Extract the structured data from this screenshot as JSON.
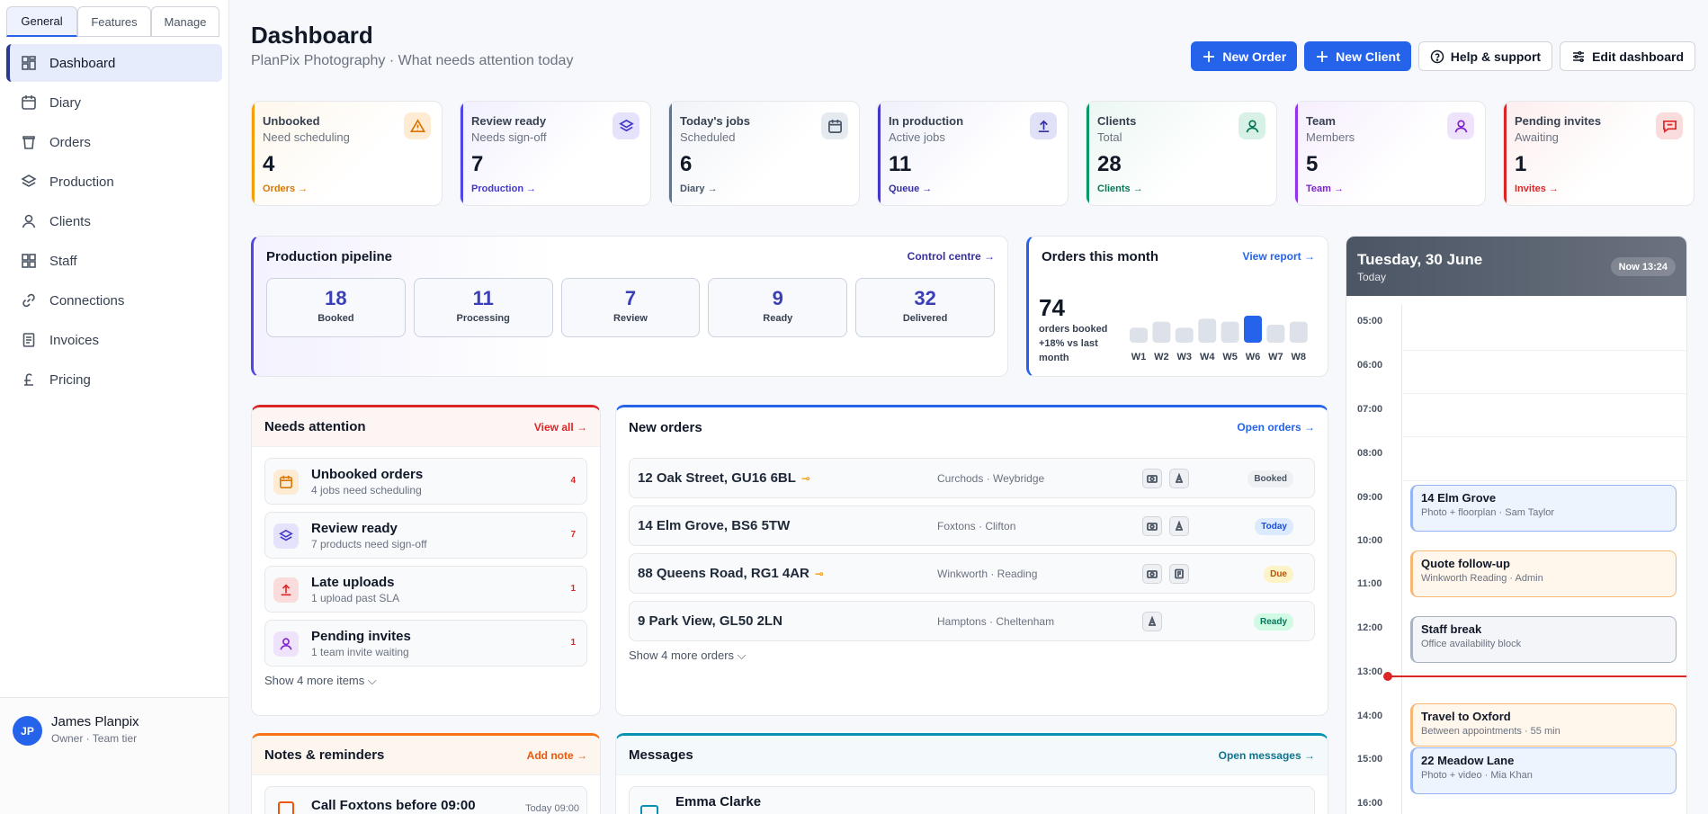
{
  "sidebar": {
    "tabs": [
      "General",
      "Features",
      "Manage"
    ],
    "items": [
      {
        "label": "Dashboard",
        "icon": "dashboard-icon"
      },
      {
        "label": "Diary",
        "icon": "calendar-icon"
      },
      {
        "label": "Orders",
        "icon": "bag-icon"
      },
      {
        "label": "Production",
        "icon": "layers-icon"
      },
      {
        "label": "Clients",
        "icon": "user-icon"
      },
      {
        "label": "Staff",
        "icon": "grid-icon"
      },
      {
        "label": "Connections",
        "icon": "link-icon"
      },
      {
        "label": "Invoices",
        "icon": "receipt-icon"
      },
      {
        "label": "Pricing",
        "icon": "pound-icon"
      }
    ],
    "user": {
      "initials": "JP",
      "name": "James Planpix",
      "role": "Owner · Team tier"
    }
  },
  "header": {
    "title": "Dashboard",
    "subtitle": "PlanPix Photography · What needs attention today",
    "new_order": "New Order",
    "new_client": "New Client",
    "help": "Help & support",
    "edit": "Edit dashboard"
  },
  "stats": [
    {
      "title": "Unbooked",
      "sub": "Need scheduling",
      "value": "4",
      "link": "Orders →",
      "color": "#f59e0b"
    },
    {
      "title": "Review ready",
      "sub": "Needs sign-off",
      "value": "7",
      "link": "Production →",
      "color": "#4f46e5"
    },
    {
      "title": "Today's jobs",
      "sub": "Scheduled",
      "value": "6",
      "link": "Diary →",
      "color": "#64748b"
    },
    {
      "title": "In production",
      "sub": "Active jobs",
      "value": "11",
      "link": "Queue →",
      "color": "#4338ca"
    },
    {
      "title": "Clients",
      "sub": "Total",
      "value": "28",
      "link": "Clients →",
      "color": "#059669"
    },
    {
      "title": "Team",
      "sub": "Members",
      "value": "5",
      "link": "Team →",
      "color": "#9333ea"
    },
    {
      "title": "Pending invites",
      "sub": "Awaiting",
      "value": "1",
      "link": "Invites →",
      "color": "#dc2626"
    }
  ],
  "pipeline": {
    "title": "Production pipeline",
    "link": "Control centre →",
    "stages": [
      {
        "value": "18",
        "label": "Booked"
      },
      {
        "value": "11",
        "label": "Processing"
      },
      {
        "value": "7",
        "label": "Review"
      },
      {
        "value": "9",
        "label": "Ready"
      },
      {
        "value": "32",
        "label": "Delivered"
      }
    ]
  },
  "orders_month": {
    "title": "Orders this month",
    "link": "View report →",
    "value": "74",
    "caption": "orders booked +18% vs last month",
    "chart_data": {
      "type": "bar",
      "categories": [
        "W1",
        "W2",
        "W3",
        "W4",
        "W5",
        "W6",
        "W7",
        "W8"
      ],
      "values": [
        5,
        7,
        5,
        8,
        7,
        9,
        6,
        7
      ],
      "highlight_index": 5
    }
  },
  "attention": {
    "title": "Needs attention",
    "link": "View all →",
    "items": [
      {
        "title": "Unbooked orders",
        "sub": "4 jobs need scheduling",
        "count": "4"
      },
      {
        "title": "Review ready",
        "sub": "7 products need sign-off",
        "count": "7"
      },
      {
        "title": "Late uploads",
        "sub": "1 upload past SLA",
        "count": "1"
      },
      {
        "title": "Pending invites",
        "sub": "1 team invite waiting",
        "count": "1"
      }
    ],
    "more": "Show 4 more items ⌵"
  },
  "new_orders": {
    "title": "New orders",
    "link": "Open orders →",
    "items": [
      {
        "address": "12 Oak Street, GU16 6BL",
        "key": true,
        "client": "Curchods · Weybridge",
        "status": "Booked"
      },
      {
        "address": "14 Elm Grove, BS6 5TW",
        "key": false,
        "client": "Foxtons · Clifton",
        "status": "Today"
      },
      {
        "address": "88 Queens Road, RG1 4AR",
        "key": true,
        "client": "Winkworth · Reading",
        "status": "Due"
      },
      {
        "address": "9 Park View, GL50 2LN",
        "key": false,
        "client": "Hamptons · Cheltenham",
        "status": "Ready"
      }
    ],
    "more": "Show 4 more orders ⌵"
  },
  "notes": {
    "title": "Notes & reminders",
    "link": "Add note →",
    "first": "Call Foxtons before 09:00",
    "first_time": "Today 09:00"
  },
  "messages": {
    "title": "Messages",
    "link": "Open messages →",
    "first": "Emma Clarke"
  },
  "diary": {
    "date": "Tuesday, 30 June",
    "today": "Today",
    "now": "Now 13:24",
    "hours": [
      "05:00",
      "06:00",
      "07:00",
      "08:00",
      "09:00",
      "10:00",
      "11:00",
      "12:00",
      "13:00",
      "14:00",
      "15:00",
      "16:00"
    ],
    "events": [
      {
        "title": "14 Elm Grove",
        "sub": "Photo + floorplan · Sam Taylor",
        "kind": "blue"
      },
      {
        "title": "Quote follow-up",
        "sub": "Winkworth Reading · Admin",
        "kind": "orange"
      },
      {
        "title": "Staff break",
        "sub": "Office availability block",
        "kind": "gray"
      },
      {
        "title": "Travel to Oxford",
        "sub": "Between appointments · 55 min",
        "kind": "orange"
      },
      {
        "title": "22 Meadow Lane",
        "sub": "Photo + video · Mia Khan",
        "kind": "blue"
      }
    ]
  }
}
